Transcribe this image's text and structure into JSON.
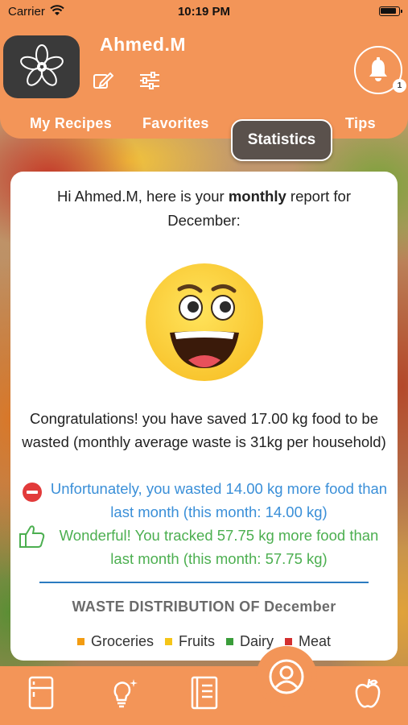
{
  "status_bar": {
    "carrier": "Carrier",
    "time": "10:19 PM"
  },
  "header": {
    "username": "Ahmed.M",
    "notification_count": "1"
  },
  "tabs": [
    {
      "label": "My Recipes"
    },
    {
      "label": "Favorites"
    },
    {
      "label": "Statistics",
      "selected": true
    },
    {
      "label": "Tips"
    }
  ],
  "report": {
    "greeting_prefix": "Hi Ahmed.M, here is your ",
    "greeting_bold": "monthly",
    "greeting_suffix": " report for December:",
    "congrats": "Congratulations! you have saved 17.00 kg food to be wasted (monthly average waste is 31kg per household)",
    "unfortunately": "Unfortunately, you wasted 14.00 kg more food than last month (this month: 14.00 kg)",
    "wonderful": "Wonderful! You tracked 57.75 kg more food than last month (this month: 57.75 kg)",
    "waste_title": "WASTE DISTRIBUTION OF December"
  },
  "legend": [
    {
      "label": "Groceries",
      "color": "#f39c12"
    },
    {
      "label": "Fruits",
      "color": "#f5c518"
    },
    {
      "label": "Dairy",
      "color": "#3a9d3a"
    },
    {
      "label": "Meat",
      "color": "#d32f2f"
    }
  ],
  "colors": {
    "accent": "#f39558",
    "selected_tab": "#5a514c",
    "negative_text": "#3a8fd8",
    "positive_text": "#4caf50"
  },
  "bottom_nav": [
    {
      "icon": "fridge-icon"
    },
    {
      "icon": "lightbulb-icon"
    },
    {
      "icon": "book-icon"
    },
    {
      "icon": "profile-icon",
      "selected": true
    },
    {
      "icon": "apple-icon"
    }
  ]
}
